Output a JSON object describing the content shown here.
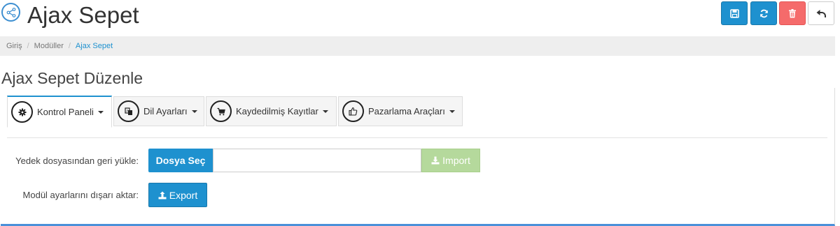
{
  "header": {
    "title": "Ajax Sepet",
    "buttons": {
      "save_icon": "save-icon",
      "refresh_icon": "refresh-icon",
      "delete_icon": "trash-icon",
      "back_icon": "reply-icon"
    },
    "colors": {
      "primary": "#1e91cf",
      "danger": "#f56b6b"
    }
  },
  "breadcrumb": {
    "items": [
      "Giriş",
      "Modüller",
      "Ajax Sepet"
    ]
  },
  "panel": {
    "title": "Ajax Sepet Düzenle",
    "tabs": [
      {
        "label": "Kontrol Paneli",
        "icon": "gear-icon",
        "active": true
      },
      {
        "label": "Dil Ayarları",
        "icon": "language-icon",
        "active": false
      },
      {
        "label": "Kaydedilmiş Kayıtlar",
        "icon": "cart-icon",
        "active": false
      },
      {
        "label": "Pazarlama Araçları",
        "icon": "thumbs-up-icon",
        "active": false
      }
    ]
  },
  "form": {
    "restore_label": "Yedek dosyasından geri yükle:",
    "choose_file_label": "Dosya Seç",
    "import_label": "Import",
    "export_row_label": "Modül ayarlarını dışarı aktar:",
    "export_label": "Export"
  }
}
